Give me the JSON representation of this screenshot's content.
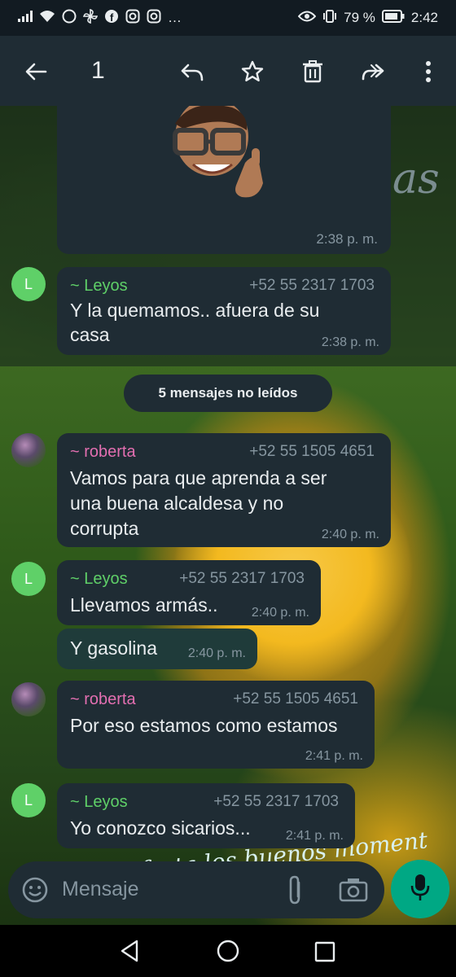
{
  "status_bar": {
    "signal_icons": "…",
    "battery_percent": "79 %",
    "time": "2:42"
  },
  "header": {
    "selected_count": "1"
  },
  "chat": {
    "sticker_time": "2:38 p. m.",
    "unread_banner": "5 mensajes no leídos",
    "messages": [
      {
        "sender": "~ Leyos",
        "phone": "+52 55 2317 1703",
        "text_lines": [
          "Y la quemamos.. afuera de su",
          "casa"
        ],
        "time": "2:38 p. m.",
        "avatar": "L"
      },
      {
        "sender": "~ roberta",
        "phone": "+52 55 1505 4651",
        "text_lines": [
          "Vamos para que aprenda a ser",
          "una buena alcaldesa y no",
          "corrupta"
        ],
        "time": "2:40 p. m."
      },
      {
        "sender": "~ Leyos",
        "phone": "+52 55 2317 1703",
        "text_lines": [
          "Llevamos armás.."
        ],
        "time": "2:40 p. m.",
        "avatar": "L"
      },
      {
        "text_lines": [
          "Y gasolina"
        ],
        "time": "2:40 p. m."
      },
      {
        "sender": "~ roberta",
        "phone": "+52 55 1505 4651",
        "text_lines": [
          "Por eso estamos como estamos"
        ],
        "time": "2:41 p. m."
      },
      {
        "sender": "~ Leyos",
        "phone": "+52 55 2317 1703",
        "text_lines": [
          "Yo conozco sicarios..."
        ],
        "time": "2:41 p. m.",
        "avatar": "L"
      }
    ],
    "wallpaper_text_top": "as",
    "wallpaper_text_bottom": "Disfruta los buenos moment"
  },
  "composer": {
    "placeholder": "Mensaje"
  },
  "colors": {
    "leyos_name": "#53bdeb",
    "roberta_name": "#e36fb1",
    "leyos_name_green": "#5fd068",
    "bubble_in": "#1f2c34",
    "bubble_out": "#005c4b",
    "accent": "#00a884"
  }
}
